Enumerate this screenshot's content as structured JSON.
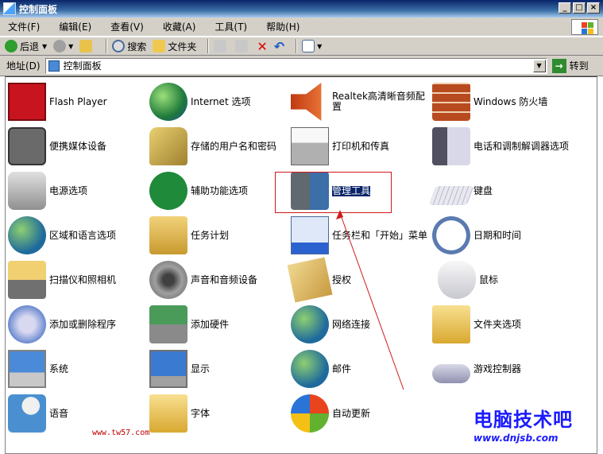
{
  "window": {
    "title": "控制面板",
    "controls": [
      "_",
      "□",
      "×"
    ]
  },
  "menu": {
    "items": [
      "文件(F)",
      "编辑(E)",
      "查看(V)",
      "收藏(A)",
      "工具(T)",
      "帮助(H)"
    ]
  },
  "toolbar": {
    "back_label": "后退",
    "search_label": "搜索",
    "folders_label": "文件夹"
  },
  "address": {
    "label": "地址(D)",
    "value": "控制面板",
    "go_label": "转到"
  },
  "items": [
    {
      "label": "Flash Player",
      "icon": "flash-player-icon"
    },
    {
      "label": "Internet 选项",
      "icon": "internet-options-icon"
    },
    {
      "label": "Realtek高清晰音频配置",
      "icon": "realtek-audio-icon"
    },
    {
      "label": "Windows 防火墙",
      "icon": "firewall-icon"
    },
    {
      "label": "便携媒体设备",
      "icon": "portable-media-icon"
    },
    {
      "label": "存储的用户名和密码",
      "icon": "keys-icon"
    },
    {
      "label": "打印机和传真",
      "icon": "printer-icon"
    },
    {
      "label": "电话和调制解调器选项",
      "icon": "phone-modem-icon"
    },
    {
      "label": "电源选项",
      "icon": "power-icon"
    },
    {
      "label": "辅助功能选项",
      "icon": "accessibility-icon"
    },
    {
      "label": "管理工具",
      "icon": "admin-tools-icon"
    },
    {
      "label": "键盘",
      "icon": "keyboard-icon"
    },
    {
      "label": "区域和语言选项",
      "icon": "globe-clock-icon"
    },
    {
      "label": "任务计划",
      "icon": "scheduled-tasks-icon"
    },
    {
      "label": "任务栏和「开始」菜单",
      "icon": "taskbar-icon"
    },
    {
      "label": "日期和时间",
      "icon": "date-time-icon"
    },
    {
      "label": "扫描仪和照相机",
      "icon": "scanner-camera-icon"
    },
    {
      "label": "声音和音频设备",
      "icon": "speaker-icon"
    },
    {
      "label": "授权",
      "icon": "license-icon"
    },
    {
      "label": "鼠标",
      "icon": "mouse-icon"
    },
    {
      "label": "添加或删除程序",
      "icon": "add-remove-programs-icon"
    },
    {
      "label": "添加硬件",
      "icon": "add-hardware-icon"
    },
    {
      "label": "网络连接",
      "icon": "network-icon"
    },
    {
      "label": "文件夹选项",
      "icon": "folder-options-icon"
    },
    {
      "label": "系统",
      "icon": "system-icon"
    },
    {
      "label": "显示",
      "icon": "display-icon"
    },
    {
      "label": "邮件",
      "icon": "mail-icon"
    },
    {
      "label": "游戏控制器",
      "icon": "game-controller-icon"
    },
    {
      "label": "语音",
      "icon": "speech-icon"
    },
    {
      "label": "字体",
      "icon": "fonts-icon"
    },
    {
      "label": "自动更新",
      "icon": "auto-update-icon"
    }
  ],
  "selected": "管理工具",
  "watermarks": {
    "left": "www.tw57.com",
    "right_title": "电脑技术吧",
    "right_url": "www.dnjsb.com"
  },
  "colors": {
    "title_bar": "#0a246a",
    "selection": "#0a246a",
    "annotation_red": "#d01818",
    "watermark_blue": "#1a1aff"
  }
}
